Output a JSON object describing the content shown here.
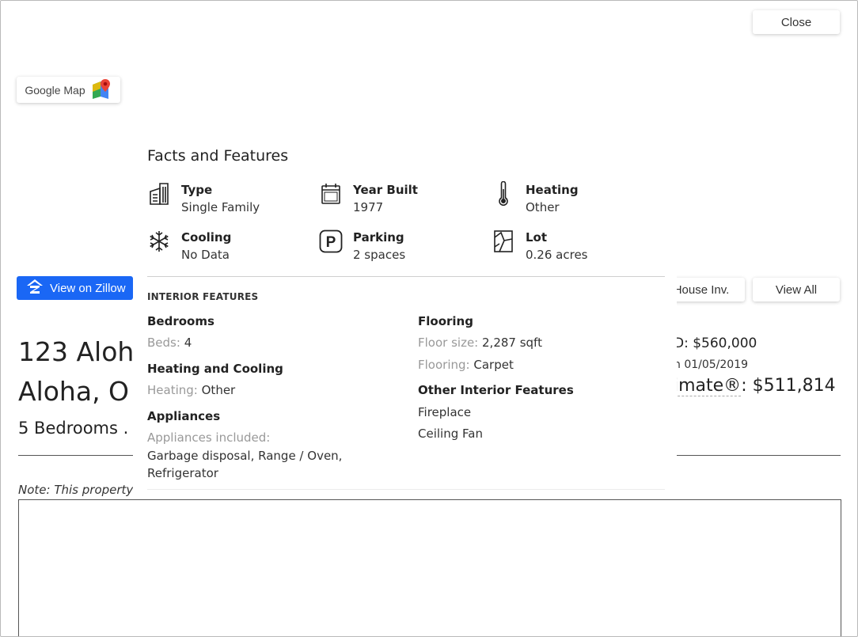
{
  "buttons": {
    "close": "Close",
    "google_map": "Google Map",
    "view_on_zillow": "View on Zillow",
    "house_inv": "House Inv.",
    "view_all": "View All"
  },
  "colors": {
    "zillow_blue": "#1a67f5"
  },
  "listing": {
    "address_line1": "123 Aloh",
    "address_line2": "Aloha, O",
    "bedrooms_line": "5 Bedrooms .",
    "sold": "D: $560,000",
    "sold_date": "n 01/05/2019",
    "estimate_label": "imate®",
    "estimate_value": ": $511,814",
    "note": "Note: This property is"
  },
  "popover": {
    "title": "Facts and Features",
    "facts": [
      {
        "icon": "building-icon",
        "title": "Type",
        "value": "Single Family"
      },
      {
        "icon": "calendar-icon",
        "title": "Year Built",
        "value": "1977"
      },
      {
        "icon": "thermometer-icon",
        "title": "Heating",
        "value": "Other"
      },
      {
        "icon": "snowflake-icon",
        "title": "Cooling",
        "value": "No Data"
      },
      {
        "icon": "parking-icon",
        "title": "Parking",
        "value": "2 spaces"
      },
      {
        "icon": "lot-icon",
        "title": "Lot",
        "value": "0.26 acres"
      }
    ],
    "interior_heading": "INTERIOR FEATURES",
    "bedrooms": {
      "title": "Bedrooms",
      "key": "Beds:",
      "value": "4"
    },
    "heating_cooling": {
      "title": "Heating and Cooling",
      "key": "Heating:",
      "value": "Other"
    },
    "appliances": {
      "title": "Appliances",
      "key": "Appliances included:",
      "line1": "Garbage disposal, Range / Oven,",
      "line2": "Refrigerator"
    },
    "flooring": {
      "title": "Flooring",
      "size_key": "Floor size:",
      "size_value": "2,287 sqft",
      "type_key": "Flooring:",
      "type_value": "Carpet"
    },
    "other_interior": {
      "title": "Other Interior Features",
      "items": [
        "Fireplace",
        "Ceiling Fan"
      ]
    }
  }
}
